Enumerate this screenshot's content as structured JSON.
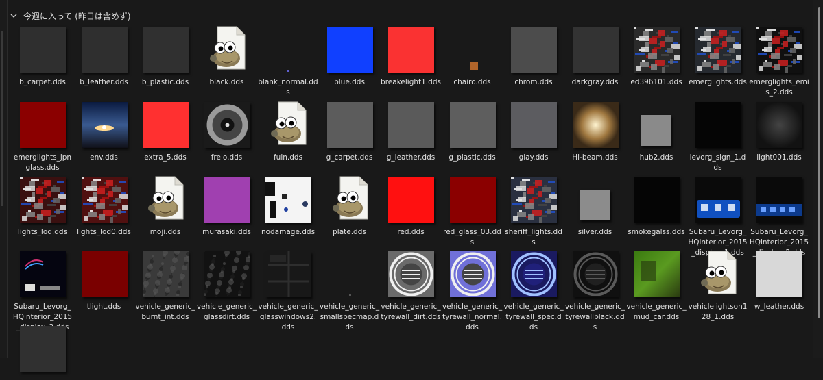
{
  "group": {
    "title": "今週に入って (昨日は含めず)"
  },
  "files": [
    {
      "name": "b_carpet.dds",
      "kind": "square",
      "color": "#2f2f2f"
    },
    {
      "name": "b_leather.dds",
      "kind": "square",
      "color": "#2f2f2f"
    },
    {
      "name": "b_plastic.dds",
      "kind": "square",
      "color": "#303030"
    },
    {
      "name": "black.dds",
      "kind": "gimp"
    },
    {
      "name": "blank_normal.dds",
      "kind": "dot",
      "color": "#6060d0"
    },
    {
      "name": "blue.dds",
      "kind": "square",
      "color": "#1040ff"
    },
    {
      "name": "breakelight1.dds",
      "kind": "square",
      "color": "#fa3232"
    },
    {
      "name": "chairo.dds",
      "kind": "tiny",
      "color": "#b0642a"
    },
    {
      "name": "chrom.dds",
      "kind": "square",
      "color": "#4c4c4c"
    },
    {
      "name": "darkgray.dds",
      "kind": "square",
      "color": "#333333"
    },
    {
      "name": "ed396101.dds",
      "kind": "tex",
      "color": "#2a2a2a"
    },
    {
      "name": "emerglights.dds",
      "kind": "tex",
      "color": "#262a30"
    },
    {
      "name": "emerglights_emis_2.dds",
      "kind": "tex",
      "color": "#101010"
    },
    {
      "name": "emerglights_jpnglass.dds",
      "kind": "square",
      "color": "#8b0000"
    },
    {
      "name": "env.dds",
      "kind": "photo"
    },
    {
      "name": "extra_5.dds",
      "kind": "square",
      "color": "#ff3030"
    },
    {
      "name": "freio.dds",
      "kind": "brake"
    },
    {
      "name": "fuin.dds",
      "kind": "gimp"
    },
    {
      "name": "g_carpet.dds",
      "kind": "square",
      "color": "#5c5c5c"
    },
    {
      "name": "g_leather.dds",
      "kind": "square",
      "color": "#5a5a5a"
    },
    {
      "name": "g_plastic.dds",
      "kind": "square",
      "color": "#5e5e5e"
    },
    {
      "name": "glay.dds",
      "kind": "square",
      "color": "#5c5c60"
    },
    {
      "name": "Hi-beam.dds",
      "kind": "hibeam"
    },
    {
      "name": "hub2.dds",
      "kind": "small",
      "color": "#8a8a8a"
    },
    {
      "name": "levorg_sign_1.dds",
      "kind": "square",
      "color": "#050505"
    },
    {
      "name": "light001.dds",
      "kind": "glow"
    },
    {
      "name": "lights_lod.dds",
      "kind": "tex",
      "color": "#3a1010"
    },
    {
      "name": "lights_lod0.dds",
      "kind": "tex",
      "color": "#501010"
    },
    {
      "name": "moji.dds",
      "kind": "gimp"
    },
    {
      "name": "murasaki.dds",
      "kind": "square",
      "color": "#a040b0"
    },
    {
      "name": "nodamage.dds",
      "kind": "nodamage"
    },
    {
      "name": "plate.dds",
      "kind": "gimp"
    },
    {
      "name": "red.dds",
      "kind": "square",
      "color": "#ff1010"
    },
    {
      "name": "red_glass_03.dds",
      "kind": "square",
      "color": "#8b0000"
    },
    {
      "name": "sheriff_lights.dds",
      "kind": "tex",
      "color": "#2a3040"
    },
    {
      "name": "silver.dds",
      "kind": "small",
      "color": "#8c8c8c"
    },
    {
      "name": "smokegalss.dds",
      "kind": "square",
      "color": "#050505"
    },
    {
      "name": "Subaru_Levorg_HQinterior_2015_display_1.dds",
      "kind": "display",
      "color": "#1050c0"
    },
    {
      "name": "Subaru_Levorg_HQinterior_2015_display_2.dds",
      "kind": "display2",
      "color": "#0c3a8c"
    },
    {
      "name": "Subaru_Levorg_HQinterior_2015_display_3.dds",
      "kind": "display3"
    },
    {
      "name": "tlight.dds",
      "kind": "square",
      "color": "#7a0000"
    },
    {
      "name": "vehicle_generic_burnt_int.dds",
      "kind": "noise",
      "color": "#3a3a3a"
    },
    {
      "name": "vehicle_generic_glassdirt.dds",
      "kind": "noise",
      "color": "#121212"
    },
    {
      "name": "vehicle_generic_glasswindows2.dds",
      "kind": "windows"
    },
    {
      "name": "vehicle_generic_smallspecmap.dds",
      "kind": "dot",
      "color": "#555555"
    },
    {
      "name": "vehicle_generic_tyrewall_dirt.dds",
      "kind": "tyre",
      "color": "#6a6a6a"
    },
    {
      "name": "vehicle_generic_tyrewall_normal.dds",
      "kind": "tyre",
      "color": "#7070d8"
    },
    {
      "name": "vehicle_generic_tyrewall_spec.dds",
      "kind": "tyrespec"
    },
    {
      "name": "vehicle_generic_tyrewallblack.dds",
      "kind": "tyreblack"
    },
    {
      "name": "vehicle_generic_mud_car.dds",
      "kind": "mud"
    },
    {
      "name": "vehiclelightson128_1.dds",
      "kind": "gimp"
    },
    {
      "name": "w_leather.dds",
      "kind": "square",
      "color": "#d8d8d8"
    },
    {
      "name": "",
      "kind": "square",
      "color": "#303030"
    }
  ]
}
